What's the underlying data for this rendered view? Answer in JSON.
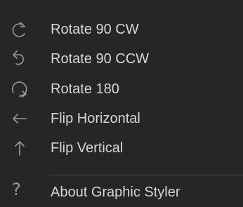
{
  "menu": {
    "items": [
      {
        "label": "Rotate 90 CW",
        "icon": "rotate-cw-icon"
      },
      {
        "label": "Rotate 90 CCW",
        "icon": "rotate-ccw-icon"
      },
      {
        "label": "Rotate 180",
        "icon": "rotate-180-icon"
      },
      {
        "label": "Flip Horizontal",
        "icon": "arrow-left-icon"
      },
      {
        "label": "Flip Vertical",
        "icon": "arrow-up-icon"
      },
      {
        "label": "About Graphic Styler",
        "icon": "question-mark-icon",
        "glyph": "?"
      }
    ]
  },
  "colors": {
    "background": "#262626",
    "text": "#d6d6d6",
    "icon": "#9a9a9a",
    "divider": "#4a4a4a"
  }
}
